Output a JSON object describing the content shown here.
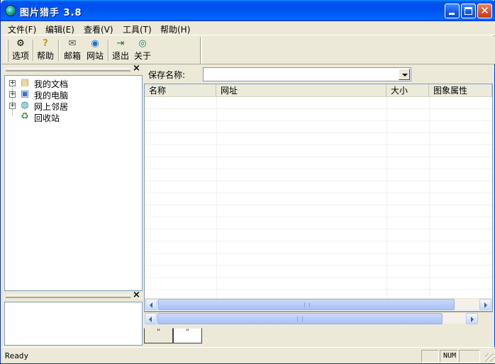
{
  "window": {
    "title": "图片猎手 3.8",
    "icon": "app-globe-icon"
  },
  "menu": [
    {
      "label": "文件(F)"
    },
    {
      "label": "编辑(E)"
    },
    {
      "label": "查看(V)"
    },
    {
      "label": "工具(T)"
    },
    {
      "label": "帮助(H)"
    }
  ],
  "toolbar": [
    {
      "label": "选项",
      "icon": "options-icon",
      "glyph": "⚙"
    },
    {
      "label": "帮助",
      "icon": "help-icon",
      "glyph": "?"
    },
    {
      "label": "邮箱",
      "icon": "mail-icon",
      "glyph": "✉"
    },
    {
      "label": "网站",
      "icon": "website-icon",
      "glyph": "◉"
    },
    {
      "label": "退出",
      "icon": "exit-icon",
      "glyph": "⇥"
    },
    {
      "label": "关于",
      "icon": "about-icon",
      "glyph": "◎"
    }
  ],
  "tree": [
    {
      "label": "我的文档",
      "icon": "folder-icon",
      "glyph": "▤",
      "expandable": true
    },
    {
      "label": "我的电脑",
      "icon": "computer-icon",
      "glyph": "▣",
      "expandable": true
    },
    {
      "label": "网上邻居",
      "icon": "network-icon",
      "glyph": "◍",
      "expandable": true
    },
    {
      "label": "回收站",
      "icon": "recycle-bin-icon",
      "glyph": "♻",
      "expandable": false
    }
  ],
  "save": {
    "label": "保存名称:",
    "value": ""
  },
  "list": {
    "columns": [
      "名称",
      "网址",
      "大小",
      "图象属性"
    ],
    "rows": []
  },
  "tabs": [
    {
      "label": "\""
    },
    {
      "label": "\""
    }
  ],
  "status": {
    "text": "Ready",
    "num": "NUM"
  }
}
